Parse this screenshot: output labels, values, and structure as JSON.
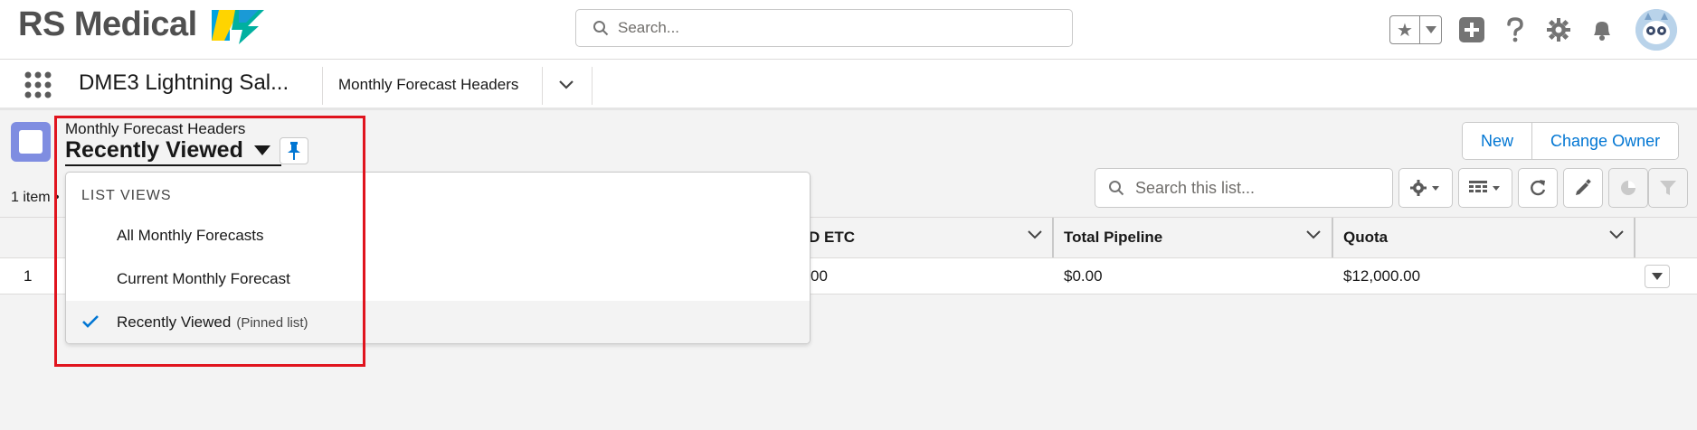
{
  "brand": {
    "name": "RS Medical"
  },
  "search": {
    "placeholder": "Search..."
  },
  "app": {
    "name": "DME3 Lightning Sal...",
    "tab": "Monthly Forecast Headers"
  },
  "list_view": {
    "object_label": "Monthly Forecast Headers",
    "title": "Recently Viewed",
    "item_count": "1 item •",
    "search_placeholder": "Search this list..."
  },
  "buttons": {
    "new": "New",
    "change_owner": "Change Owner"
  },
  "dropdown": {
    "section": "List Views",
    "items": [
      {
        "label": "All Monthly Forecasts",
        "suffix": ""
      },
      {
        "label": "Current Monthly Forecast",
        "suffix": ""
      },
      {
        "label": "Recently Viewed",
        "suffix": "(Pinned list)",
        "selected": true
      }
    ]
  },
  "table": {
    "columns": [
      "D ETC",
      "Total Pipeline",
      "Quota"
    ],
    "rows": [
      {
        "num": "1",
        "d_etc": "00",
        "total_pipeline": "$0.00",
        "quota": "$12,000.00"
      }
    ]
  },
  "icons": {
    "header": [
      "favorites-star-icon",
      "add-icon",
      "help-icon",
      "setup-gear-icon",
      "notifications-bell-icon"
    ],
    "list_tools": [
      "settings-gear-icon",
      "table-view-icon",
      "refresh-icon",
      "edit-icon",
      "chart-icon",
      "filter-icon"
    ]
  },
  "colors": {
    "accent": "#0176d3",
    "object_icon": "#7f8de1",
    "highlight": "#e0141e"
  }
}
